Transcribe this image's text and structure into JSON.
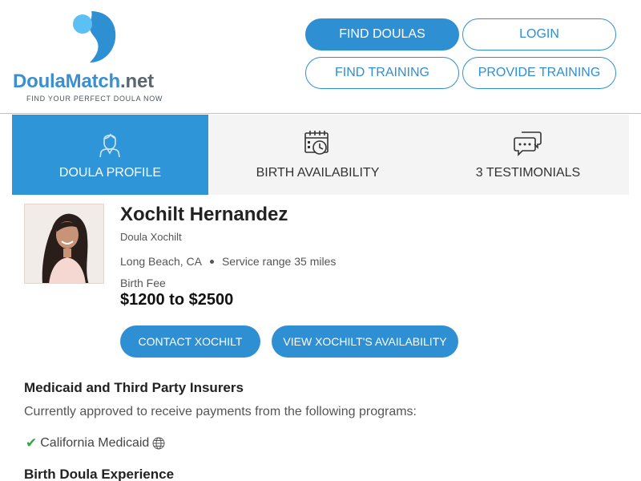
{
  "header": {
    "logo": {
      "part1": "Doula",
      "part2": "Match",
      "part3": ".net",
      "tagline": "FIND YOUR PERFECT DOULA NOW"
    },
    "nav": {
      "find_doulas": "FIND DOULAS",
      "login": "LOGIN",
      "find_training": "FIND TRAINING",
      "provide_training": "PROVIDE TRAINING"
    }
  },
  "tabs": [
    {
      "label": "DOULA PROFILE",
      "icon": "doula-person-icon",
      "active": true
    },
    {
      "label": "BIRTH AVAILABILITY",
      "icon": "calendar-clock-icon",
      "active": false
    },
    {
      "label": "3 TESTIMONIALS",
      "icon": "chat-bubbles-icon",
      "active": false
    }
  ],
  "profile": {
    "name": "Xochilt Hernandez",
    "business_name": "Doula Xochilt",
    "location": "Long Beach, CA",
    "service_range": "Service range 35 miles",
    "fee_label": "Birth Fee",
    "fee": "$1200 to $2500",
    "contact_label": "CONTACT XOCHILT",
    "availability_label": "VIEW XOCHILT'S AVAILABILITY"
  },
  "insurance": {
    "heading": "Medicaid and Third Party Insurers",
    "description": "Currently approved to receive payments from the following programs:",
    "programs": [
      "California Medicaid"
    ]
  },
  "experience": {
    "heading": "Birth Doula Experience"
  },
  "colors": {
    "brand_blue": "#2f8fd3",
    "active_tab": "#2f95d9",
    "check_green": "#2eaa3a"
  }
}
